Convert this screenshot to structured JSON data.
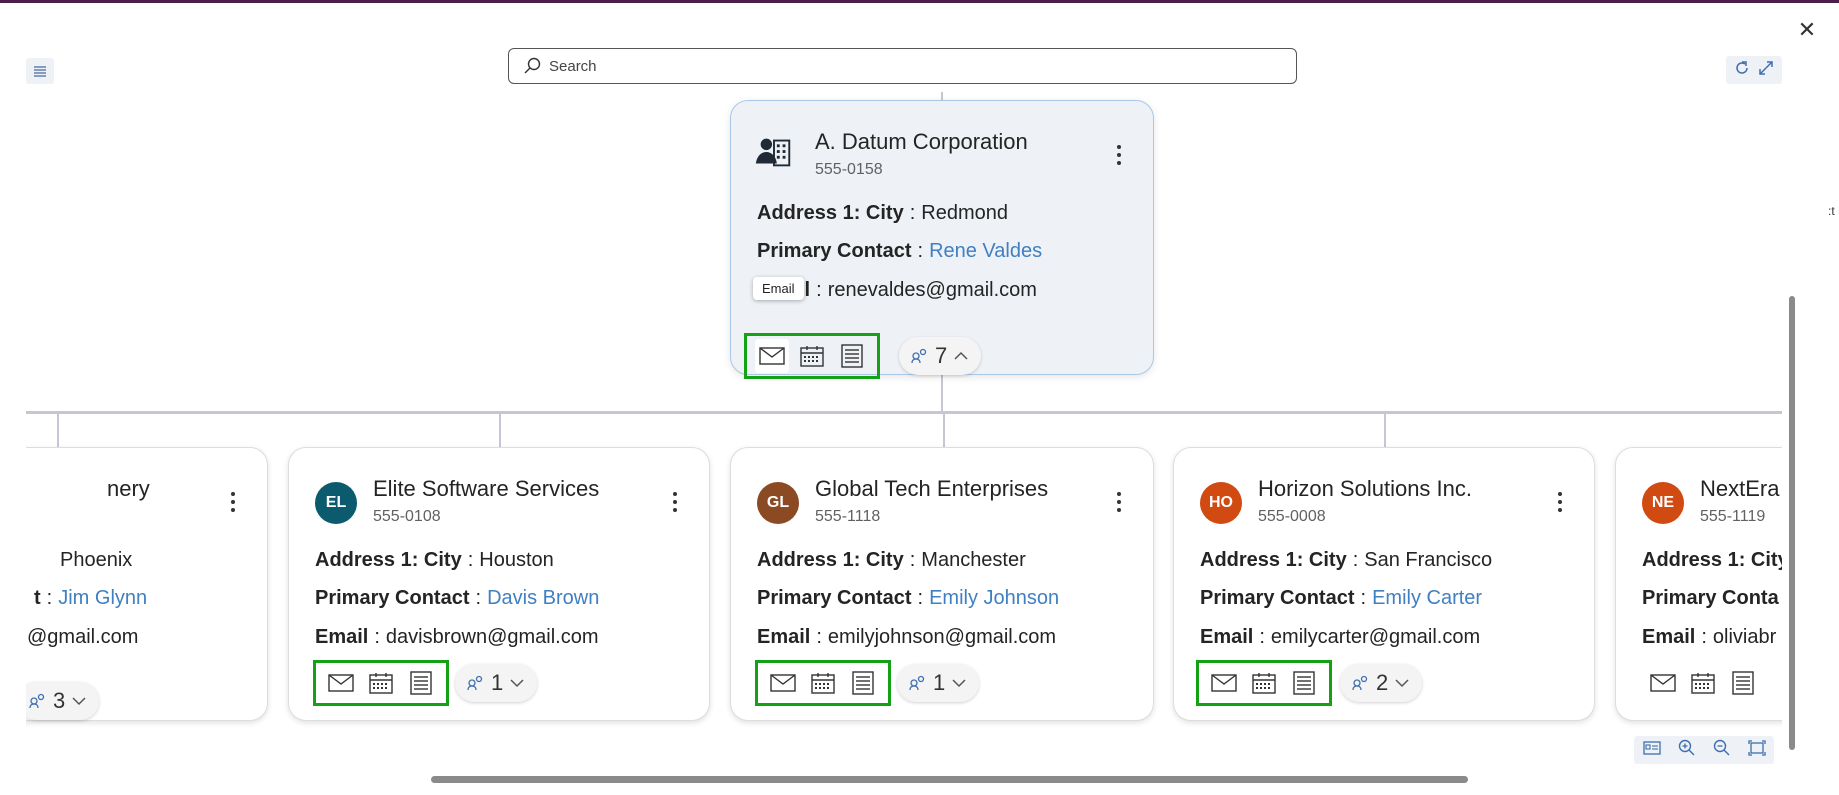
{
  "search": {
    "placeholder": "Search"
  },
  "tooltip": {
    "text": "Email"
  },
  "colors": {
    "highlight": "#15a115",
    "link": "#3f7fc2",
    "root_bg": "#eef2f6"
  },
  "root_card": {
    "name": "A. Datum Corporation",
    "phone": "555-0158",
    "city_label": "Address 1: City",
    "city": "Redmond",
    "contact_label": "Primary Contact",
    "contact": "Rene Valdes",
    "email_label": "Email",
    "email_label_visible": "il",
    "email": "renevaldes@gmail.com",
    "children_count": "7",
    "icon": "building-people-icon"
  },
  "cards": [
    {
      "name": "nery",
      "city": "Phoenix",
      "contact_label": "t",
      "contact": "Jim Glynn",
      "email": "@gmail.com",
      "children_count": "3"
    },
    {
      "initials": "EL",
      "avatar_color": "#0b5a6e",
      "name": "Elite Software Services",
      "phone": "555-0108",
      "city_label": "Address 1: City",
      "city": "Houston",
      "contact_label": "Primary Contact",
      "contact": "Davis Brown",
      "email_label": "Email",
      "email": "davisbrown@gmail.com",
      "children_count": "1"
    },
    {
      "initials": "GL",
      "avatar_color": "#8b4a24",
      "name": "Global Tech Enterprises",
      "phone": "555-1118",
      "city_label": "Address 1: City",
      "city": "Manchester",
      "contact_label": "Primary Contact",
      "contact": "Emily Johnson",
      "email_label": "Email",
      "email": "emilyjohnson@gmail.com",
      "children_count": "1"
    },
    {
      "initials": "HO",
      "avatar_color": "#d04a12",
      "name": "Horizon Solutions Inc.",
      "phone": "555-0008",
      "city_label": "Address 1: City",
      "city": "San Francisco",
      "contact_label": "Primary Contact",
      "contact": "Emily Carter",
      "email_label": "Email",
      "email": "emilycarter@gmail.com",
      "children_count": "2"
    },
    {
      "initials": "NE",
      "avatar_color": "#d04a12",
      "name": "NextEra",
      "phone": "555-1119",
      "city_label": "Address 1: City",
      "contact_label": "Primary Conta",
      "email_label": "Email",
      "email": "oliviabr"
    }
  ]
}
